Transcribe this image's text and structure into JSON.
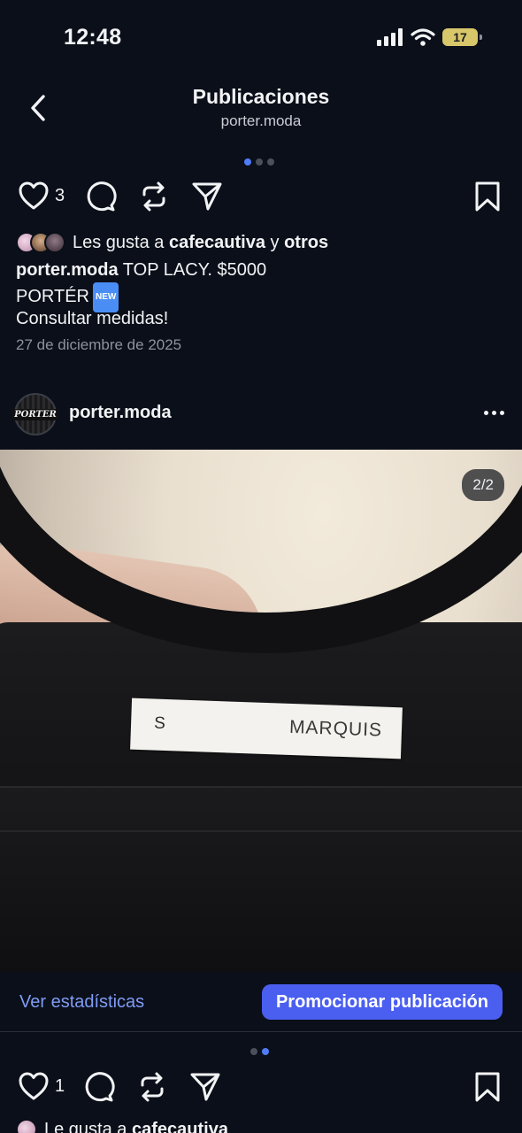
{
  "status": {
    "time": "12:48",
    "battery": "17"
  },
  "header": {
    "title": "Publicaciones",
    "subtitle": "porter.moda"
  },
  "post1": {
    "like_count": "3",
    "likes_prefix": "Les gusta a",
    "likes_user": "cafecautiva",
    "likes_and": "y",
    "likes_others": "otros",
    "caption_user": "porter.moda",
    "caption_text": "TOP LACY. $5000",
    "caption_line2": "PORTÉR",
    "new_badge": "NEW",
    "caption_line3": "Consultar medidas!",
    "date": "27 de diciembre de 2025"
  },
  "post2": {
    "username": "porter.moda",
    "profile_pic_text": "PORTER",
    "image_counter": "2/2",
    "tag_size": "S",
    "tag_brand": "MARQUIS",
    "stats_link": "Ver estadísticas",
    "promote_button": "Promocionar publicación",
    "like_count": "1",
    "likes_prefix": "Le gusta a",
    "likes_user": "cafecautiva"
  },
  "colors": {
    "background": "#0b0f19",
    "accent": "#4a5ef0",
    "link": "#7f9cf5",
    "active_dot": "#4f7cf7"
  },
  "icons": [
    "back-icon",
    "heart-icon",
    "comment-icon",
    "repost-icon",
    "share-icon",
    "bookmark-icon",
    "more-icon",
    "signal-icon",
    "wifi-icon"
  ]
}
